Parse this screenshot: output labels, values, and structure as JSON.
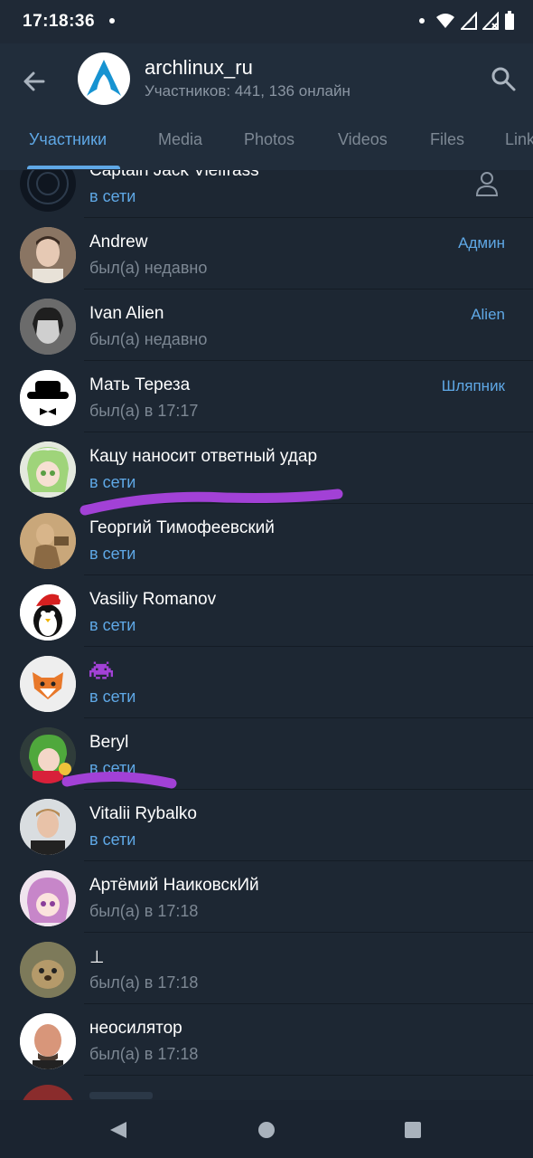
{
  "status_bar": {
    "time": "17:18:36"
  },
  "header": {
    "title": "archlinux_ru",
    "subtitle": "Участников: 441, 136 онлайн"
  },
  "tabs": [
    {
      "label": "Участники"
    },
    {
      "label": "Media"
    },
    {
      "label": "Photos"
    },
    {
      "label": "Videos"
    },
    {
      "label": "Files"
    },
    {
      "label": "Links"
    }
  ],
  "members": [
    {
      "name": "Captain Jack Vielfrass",
      "status": "в сети",
      "online": true,
      "role": ""
    },
    {
      "name": "Andrew",
      "status": "был(а) недавно",
      "online": false,
      "role": "Админ"
    },
    {
      "name": "Ivan Alien",
      "status": "был(а) недавно",
      "online": false,
      "role": "Alien"
    },
    {
      "name": "Мать Тереза",
      "status": "был(а) в 17:17",
      "online": false,
      "role": "Шляпник"
    },
    {
      "name": "Кацу наносит ответный удар",
      "status": "в сети",
      "online": true,
      "role": ""
    },
    {
      "name": "Георгий Тимофеевский",
      "status": "в сети",
      "online": true,
      "role": ""
    },
    {
      "name": "Vasiliy Romanov",
      "status": "в сети",
      "online": true,
      "role": ""
    },
    {
      "name": "",
      "status": "в сети",
      "online": true,
      "role": ""
    },
    {
      "name": "Beryl",
      "status": "в сети",
      "online": true,
      "role": ""
    },
    {
      "name": "Vitalii Rybalko",
      "status": "в сети",
      "online": true,
      "role": ""
    },
    {
      "name": "Артёмий НаиковскИй",
      "status": "был(а) в 17:18",
      "online": false,
      "role": ""
    },
    {
      "name": "⊥",
      "status": "был(а) в 17:18",
      "online": false,
      "role": ""
    },
    {
      "name": "неосилятор",
      "status": "был(а) в 17:18",
      "online": false,
      "role": ""
    }
  ],
  "colors": {
    "background": "#1d2733",
    "header": "#212d3b",
    "accent": "#5fa8e6",
    "secondary_text": "#7d8894",
    "highlight_scribble": "#a241d6"
  }
}
